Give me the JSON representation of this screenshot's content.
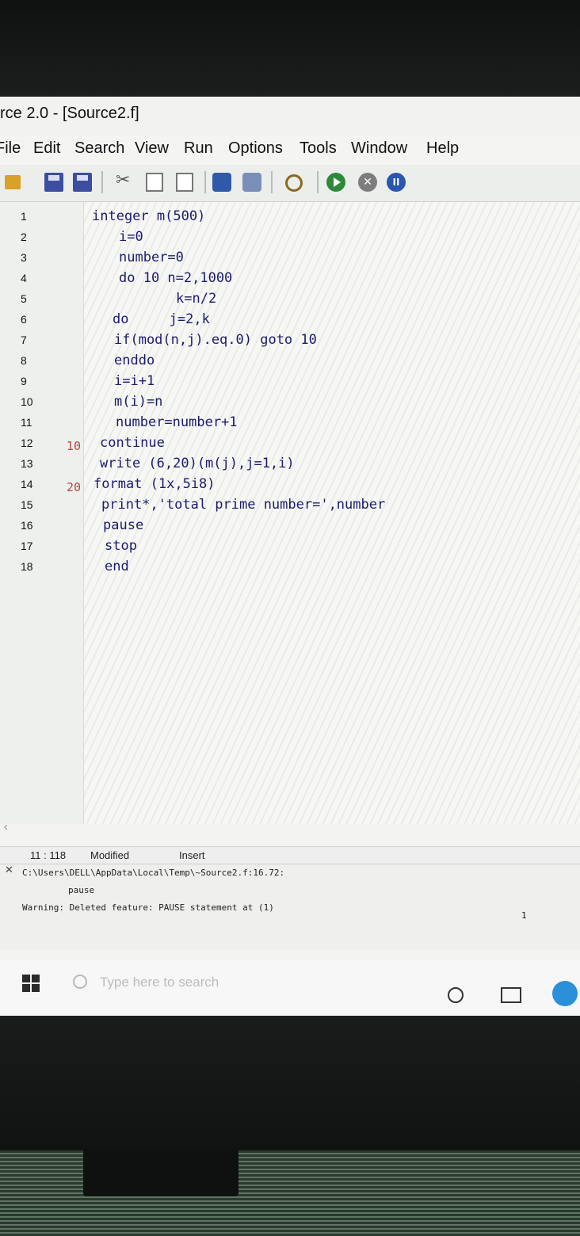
{
  "window": {
    "title": "rce 2.0 - [Source2.f]"
  },
  "menu": [
    "File",
    "Edit",
    "Search",
    "View",
    "Run",
    "Options",
    "Tools",
    "Window",
    "Help"
  ],
  "toolbar": {
    "icons": [
      "open-icon",
      "save-icon",
      "save-all-icon",
      "cut-icon",
      "copy-icon",
      "paste-icon",
      "undo-icon",
      "redo-icon",
      "find-icon",
      "run-icon",
      "stop-icon",
      "pause-icon"
    ],
    "pause_glyph": "II",
    "stop_glyph": "✕"
  },
  "editor": {
    "line_numbers": [
      "1",
      "2",
      "3",
      "4",
      "5",
      "6",
      "7",
      "8",
      "9",
      "10",
      "11",
      "12",
      "13",
      "14",
      "15",
      "16",
      "17",
      "18"
    ],
    "lines": [
      {
        "label": "",
        "code": "integer m(500)"
      },
      {
        "label": "",
        "code": "i=0"
      },
      {
        "label": "",
        "code": "number=0"
      },
      {
        "label": "",
        "code": "do 10 n=2,1000"
      },
      {
        "label": "",
        "code": "k=n/2"
      },
      {
        "label": "",
        "code": "do     j=2,k"
      },
      {
        "label": "",
        "code": "if(mod(n,j).eq.0) goto 10"
      },
      {
        "label": "",
        "code": "enddo"
      },
      {
        "label": "",
        "code": "i=i+1"
      },
      {
        "label": "",
        "code": "m(i)=n"
      },
      {
        "label": "",
        "code": "number=number+1"
      },
      {
        "label": "10",
        "code": "continue"
      },
      {
        "label": "",
        "code": "write (6,20)(m(j),j=1,i)"
      },
      {
        "label": "20",
        "code": "format (1x,5i8)"
      },
      {
        "label": "",
        "code": "print*,'total prime number=',number"
      },
      {
        "label": "",
        "code": "pause"
      },
      {
        "label": "",
        "code": "stop"
      },
      {
        "label": "",
        "code": "end"
      }
    ]
  },
  "status": {
    "position": "11 : 118",
    "state": "Modified",
    "mode": "Insert"
  },
  "output": {
    "close_glyph": "✕",
    "path": "C:\\Users\\DELL\\AppData\\Local\\Temp\\~Source2.f:16.72:",
    "context": "pause",
    "warning": "Warning: Deleted feature: PAUSE statement at (1)",
    "marker": "1"
  },
  "taskbar": {
    "search_placeholder": "Type here to search"
  }
}
